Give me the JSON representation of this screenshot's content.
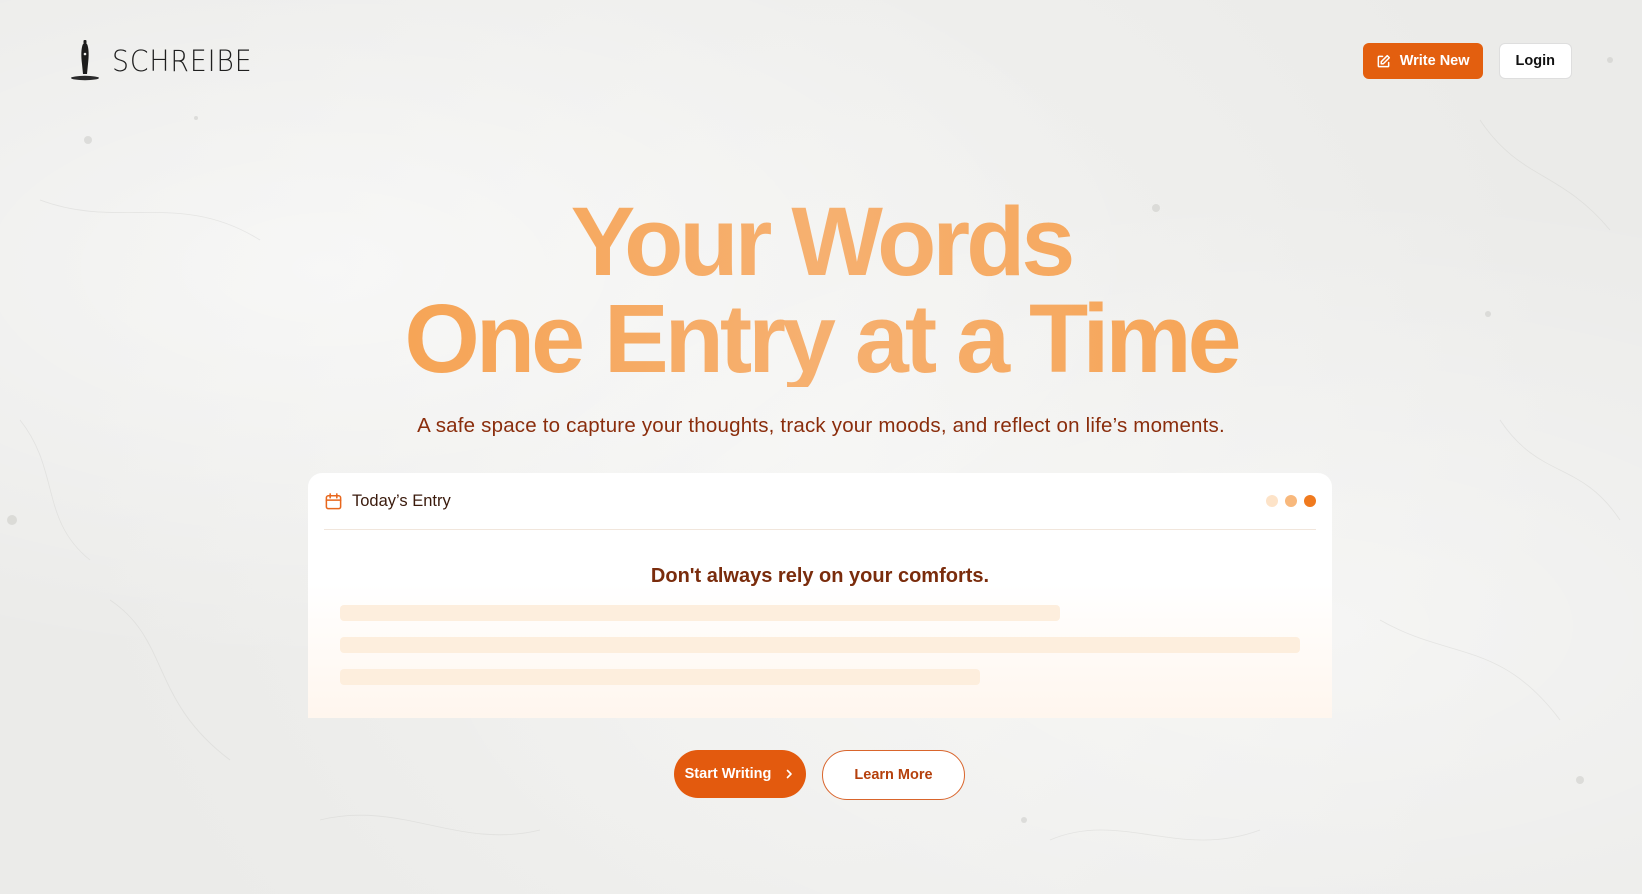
{
  "brand": {
    "name": "SCHREIBE",
    "accent": "#e35f0f",
    "headline_gradient": [
      "#f59a3e",
      "#f6b070"
    ]
  },
  "header": {
    "write_new_label": "Write New",
    "login_label": "Login",
    "write_icon": "pencil-square-icon"
  },
  "hero": {
    "line1": "Your Words",
    "line2": "One Entry at a Time",
    "subtitle": "A safe space to capture your thoughts, track your moods, and reflect on life’s moments."
  },
  "card": {
    "icon": "calendar-icon",
    "title": "Today’s Entry",
    "dots": [
      {
        "color": "#fde3c8"
      },
      {
        "color": "#f8b87c"
      },
      {
        "color": "#f07a1e"
      }
    ],
    "quote": "Don't always rely on your comforts."
  },
  "cta": {
    "start_label": "Start Writing",
    "learn_label": "Learn More",
    "start_icon": "chevron-right-icon"
  }
}
